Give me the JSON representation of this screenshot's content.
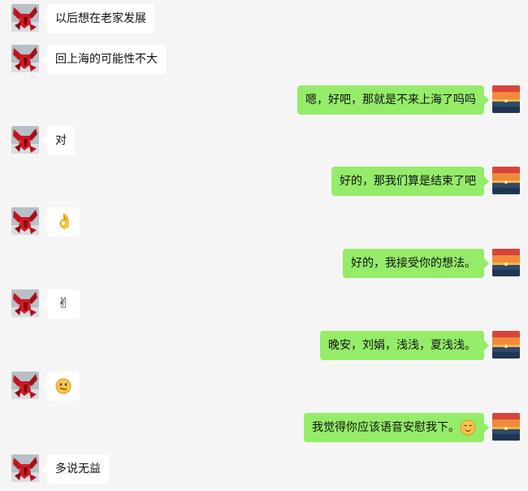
{
  "messages": [
    {
      "side": "in",
      "text": "以后想在老家发展"
    },
    {
      "side": "in",
      "text": "回上海的可能性不大"
    },
    {
      "side": "out",
      "text": "嗯，好吧，那就是不来上海了吗吗"
    },
    {
      "side": "in",
      "text": "对"
    },
    {
      "side": "out",
      "text": "好的，那我们算是结束了吧"
    },
    {
      "side": "in",
      "emoji": "ok-hand-icon"
    },
    {
      "side": "out",
      "text": "好的，我接受你的想法。"
    },
    {
      "side": "in",
      "emoji": "victory-hand-icon"
    },
    {
      "side": "out",
      "text": "晚安，刘娟，浅浅，夏浅浅。"
    },
    {
      "side": "in",
      "emoji": "awkward-smile-icon"
    },
    {
      "side": "out",
      "text": "我觉得你应该语音安慰我下。",
      "trailing_emoji": "blush-smile-icon"
    },
    {
      "side": "in",
      "text": "多说无益"
    }
  ],
  "glyphs": {
    "ok_hand": "👌",
    "victory_hand": "✌"
  },
  "colors": {
    "background": "#f5f5f5",
    "incoming_bubble": "#ffffff",
    "outgoing_bubble": "#95ec69"
  }
}
